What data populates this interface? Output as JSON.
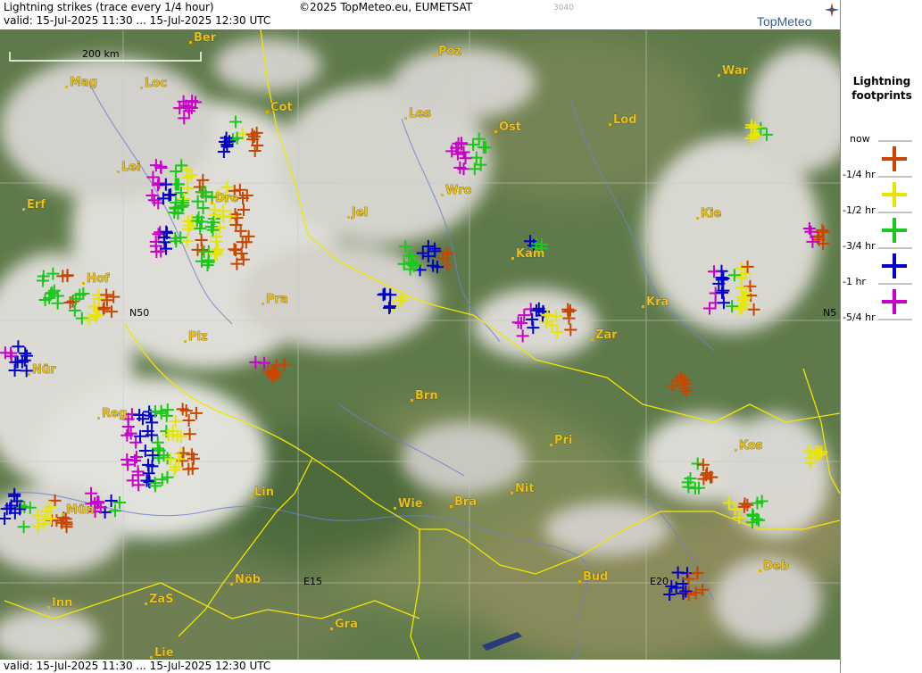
{
  "header": {
    "title": "Lightning strikes (trace every 1/4 hour)",
    "copyright": "©2025 TopMeteo.eu, EUMETSAT",
    "code": "3040",
    "valid_top": "valid:  15-Jul-2025 11:30 ... 15-Jul-2025 12:30 UTC",
    "brand": "TopMeteo"
  },
  "footer": {
    "valid_bottom": "valid:  15-Jul-2025 11:30 ... 15-Jul-2025 12:30 UTC"
  },
  "map": {
    "scale_label": "200 km",
    "grid_labels": [
      "N50",
      "N5",
      "E15",
      "E20"
    ],
    "cities": [
      "Ber",
      "Poz",
      "War",
      "Mag",
      "Loc",
      "Cot",
      "Les",
      "Ost",
      "Lod",
      "Lei",
      "Erf",
      "Dre",
      "Wro",
      "Jel",
      "Kie",
      "Kam",
      "Hof",
      "Pra",
      "Kra",
      "Plz",
      "Zar",
      "Nür",
      "Brn",
      "Reg",
      "Pri",
      "Kos",
      "Lin",
      "Wie",
      "Bra",
      "Nit",
      "Mün",
      "Deb",
      "Nöb",
      "Bud",
      "Inn",
      "ZaS",
      "Gra",
      "Lie"
    ],
    "colors": {
      "now": "#c84600",
      "q1": "#e6e600",
      "q2": "#19c819",
      "q3": "#0000c8",
      "q4": "#c800c8"
    }
  },
  "legend": {
    "title_line1": "Lightning",
    "title_line2": "footprints",
    "items": [
      {
        "label": "now",
        "color": "#c84600"
      },
      {
        "label": "-1/4 hr",
        "color": "#e6e600"
      },
      {
        "label": "-1/2 hr",
        "color": "#19c819"
      },
      {
        "label": "-3/4 hr",
        "color": "#0000c8"
      },
      {
        "label": "-1 hr",
        "color": "#c800c8"
      },
      {
        "label": "-5/4 hr",
        "color": "#c800c8"
      }
    ]
  }
}
